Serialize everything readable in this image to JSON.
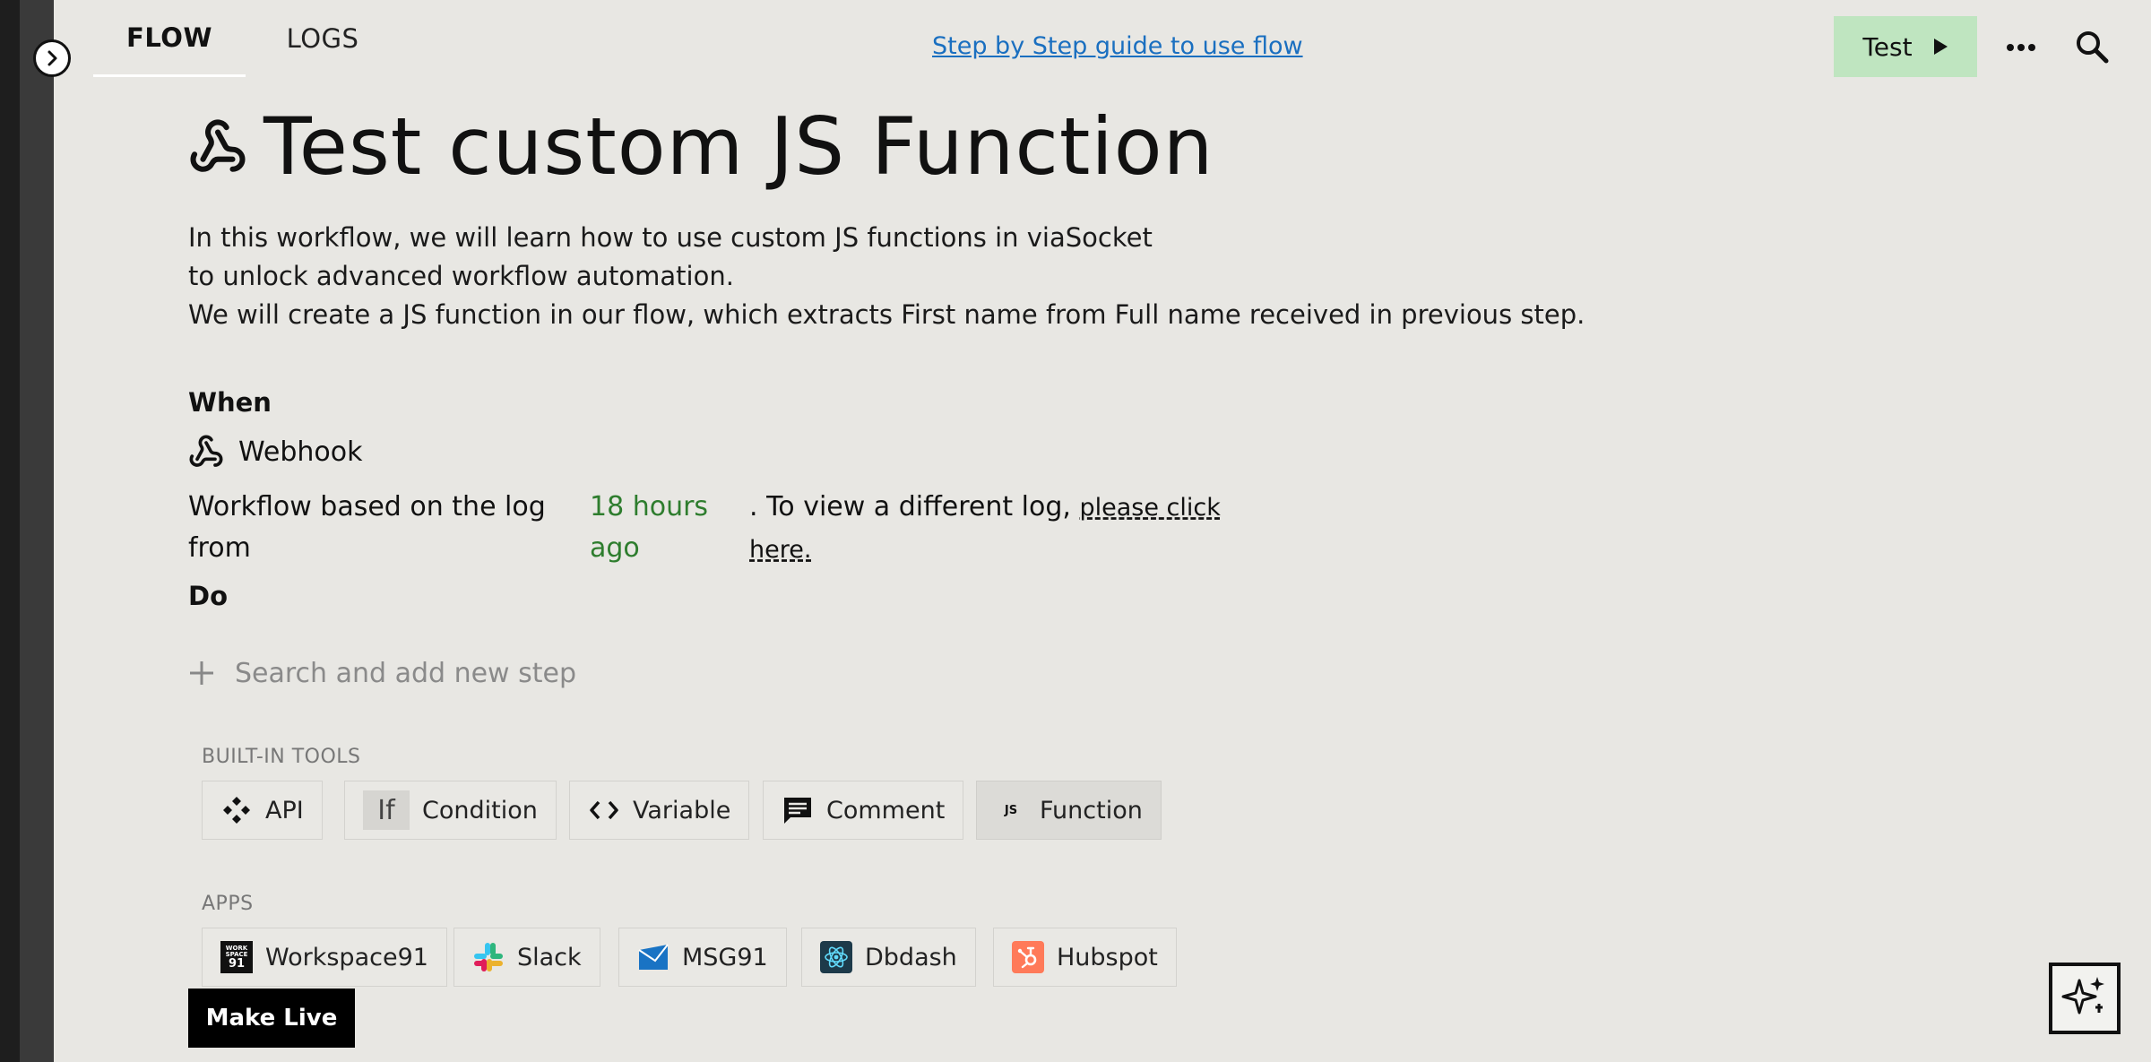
{
  "header": {
    "tabs": [
      {
        "label": "FLOW",
        "active": true
      },
      {
        "label": "LOGS",
        "active": false
      }
    ],
    "guide_link": "Step by Step guide to use flow",
    "test_button": "Test"
  },
  "flow": {
    "title": "Test custom JS Function",
    "description": [
      "In this workflow, we will learn how to use custom JS functions in viaSocket",
      "to unlock advanced workflow automation.",
      "We will create a JS function in our flow, which extracts First name from Full name received in previous step."
    ],
    "when_label": "When",
    "trigger_name": "Webhook",
    "log_prefix": "Workflow based on the log from",
    "log_time": "18 hours ago",
    "log_suffix": ".  To view a different log,",
    "log_link": "please click here.",
    "do_label": "Do",
    "add_step_placeholder": "Search and add new step"
  },
  "tools": {
    "heading": "BUILT-IN TOOLS",
    "items": [
      {
        "label": "API",
        "icon": "api-icon"
      },
      {
        "label": "Condition",
        "icon": "condition-icon"
      },
      {
        "label": "Variable",
        "icon": "code-brackets-icon"
      },
      {
        "label": "Comment",
        "icon": "comment-icon"
      },
      {
        "label": "Function",
        "icon": "js-icon"
      }
    ]
  },
  "apps": {
    "heading": "APPS",
    "items": [
      {
        "label": "Workspace91",
        "icon": "workspace91-icon"
      },
      {
        "label": "Slack",
        "icon": "slack-icon"
      },
      {
        "label": "MSG91",
        "icon": "msg91-icon"
      },
      {
        "label": "Dbdash",
        "icon": "dbdash-icon"
      },
      {
        "label": "Hubspot",
        "icon": "hubspot-icon"
      }
    ]
  },
  "footer": {
    "make_live": "Make Live"
  },
  "colors": {
    "background": "#e8e7e3",
    "test_button": "#bfe5c0",
    "link": "#1a6fc0",
    "log_time": "#2e7d2e"
  }
}
